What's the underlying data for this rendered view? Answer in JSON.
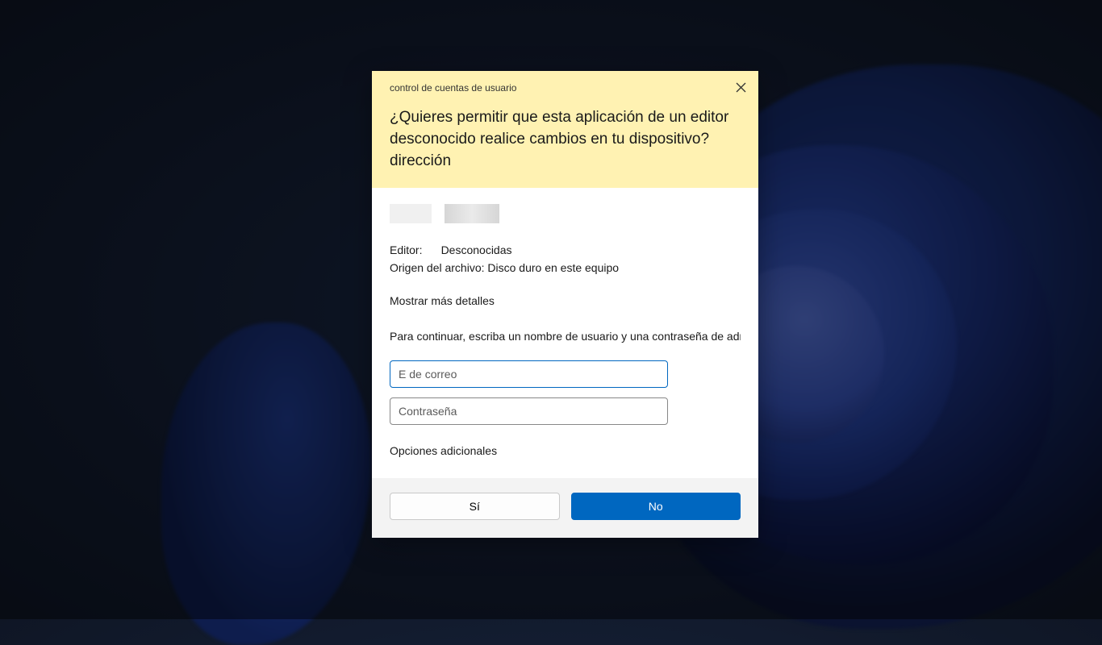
{
  "uac": {
    "title": "control de cuentas de usuario",
    "question": "¿Quieres permitir que esta aplicación de un editor desconocido realice cambios en tu dispositivo? dirección",
    "publisher_label": "Editor:",
    "publisher_value": "Desconocidas",
    "origin_full": "Origen del archivo: Disco duro en este equipo",
    "details_link": "Mostrar más detalles",
    "instruction": "Para continuar, escriba un nombre de usuario y una contraseña de administrador.",
    "email_placeholder": "E de correo",
    "password_placeholder": "Contraseña",
    "additional_options": "Opciones adicionales",
    "yes_label": "Sí",
    "no_label": "No"
  }
}
